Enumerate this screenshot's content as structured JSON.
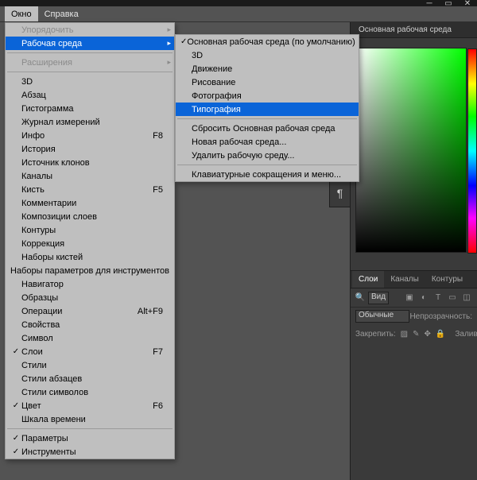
{
  "menubar": {
    "window": "Окно",
    "help": "Справка"
  },
  "window_menu": {
    "arrange": "Упорядочить",
    "workspace": "Рабочая среда",
    "extensions": "Расширения",
    "items": [
      {
        "label": "3D",
        "shortcut": "",
        "checked": false
      },
      {
        "label": "Абзац",
        "shortcut": "",
        "checked": false
      },
      {
        "label": "Гистограмма",
        "shortcut": "",
        "checked": false
      },
      {
        "label": "Журнал измерений",
        "shortcut": "",
        "checked": false
      },
      {
        "label": "Инфо",
        "shortcut": "F8",
        "checked": false
      },
      {
        "label": "История",
        "shortcut": "",
        "checked": false
      },
      {
        "label": "Источник клонов",
        "shortcut": "",
        "checked": false
      },
      {
        "label": "Каналы",
        "shortcut": "",
        "checked": false
      },
      {
        "label": "Кисть",
        "shortcut": "F5",
        "checked": false
      },
      {
        "label": "Комментарии",
        "shortcut": "",
        "checked": false
      },
      {
        "label": "Композиции слоев",
        "shortcut": "",
        "checked": false
      },
      {
        "label": "Контуры",
        "shortcut": "",
        "checked": false
      },
      {
        "label": "Коррекция",
        "shortcut": "",
        "checked": false
      },
      {
        "label": "Наборы кистей",
        "shortcut": "",
        "checked": false
      },
      {
        "label": "Наборы параметров для инструментов",
        "shortcut": "",
        "checked": false
      },
      {
        "label": "Навигатор",
        "shortcut": "",
        "checked": false
      },
      {
        "label": "Образцы",
        "shortcut": "",
        "checked": false
      },
      {
        "label": "Операции",
        "shortcut": "Alt+F9",
        "checked": false
      },
      {
        "label": "Свойства",
        "shortcut": "",
        "checked": false
      },
      {
        "label": "Символ",
        "shortcut": "",
        "checked": false
      },
      {
        "label": "Слои",
        "shortcut": "F7",
        "checked": true
      },
      {
        "label": "Стили",
        "shortcut": "",
        "checked": false
      },
      {
        "label": "Стили абзацев",
        "shortcut": "",
        "checked": false
      },
      {
        "label": "Стили символов",
        "shortcut": "",
        "checked": false
      },
      {
        "label": "Цвет",
        "shortcut": "F6",
        "checked": true
      },
      {
        "label": "Шкала времени",
        "shortcut": "",
        "checked": false
      }
    ],
    "footer": [
      {
        "label": "Параметры",
        "checked": true
      },
      {
        "label": "Инструменты",
        "checked": true
      }
    ]
  },
  "workspace_submenu": {
    "items": [
      {
        "label": "Основная рабочая среда (по умолчанию)",
        "checked": true
      },
      {
        "label": "3D",
        "checked": false
      },
      {
        "label": "Движение",
        "checked": false
      },
      {
        "label": "Рисование",
        "checked": false
      },
      {
        "label": "Фотография",
        "checked": false
      },
      {
        "label": "Типография",
        "checked": false,
        "highlight": true
      }
    ],
    "section2": [
      "Сбросить Основная рабочая среда",
      "Новая рабочая среда...",
      "Удалить рабочую среду..."
    ],
    "section3": [
      "Клавиатурные сокращения и меню..."
    ]
  },
  "panels": {
    "workspace_drop_label": "Основная рабочая среда",
    "layers_tabs": {
      "layers": "Слои",
      "channels": "Каналы",
      "paths": "Контуры"
    },
    "filter_label": "Вид",
    "blend_mode": "Обычные",
    "opacity_label": "Непрозрачность:",
    "lock_label": "Закрепить:",
    "fill_label": "Заливка:",
    "pilcrow": "¶"
  }
}
